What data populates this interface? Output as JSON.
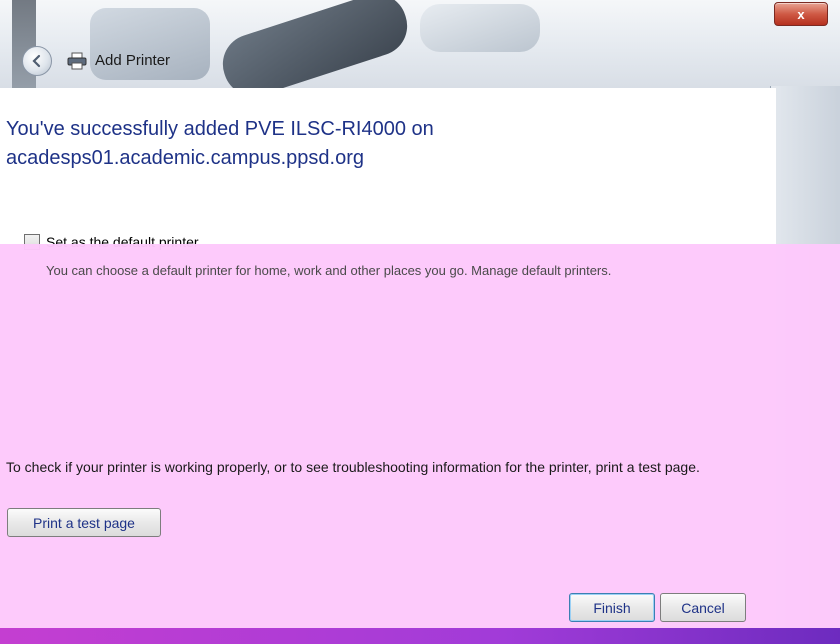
{
  "window": {
    "title": "Add Printer",
    "close_label": "x"
  },
  "content": {
    "heading": "You've successfully added PVE ILSC-RI4000 on acadesps01.academic.campus.ppsd.org",
    "default_checkbox_label": "Set as the default printer",
    "default_checkbox_description": "You can choose a default printer for home, work and other places you go. Manage default printers.",
    "test_description": "To check if your printer is working properly, or to see troubleshooting information for the printer, print a test page.",
    "test_button_label": "Print a test page"
  },
  "footer": {
    "finish_label": "Finish",
    "cancel_label": "Cancel"
  },
  "colors": {
    "heading": "#1e3287",
    "overlay": "#fdc8fb"
  }
}
